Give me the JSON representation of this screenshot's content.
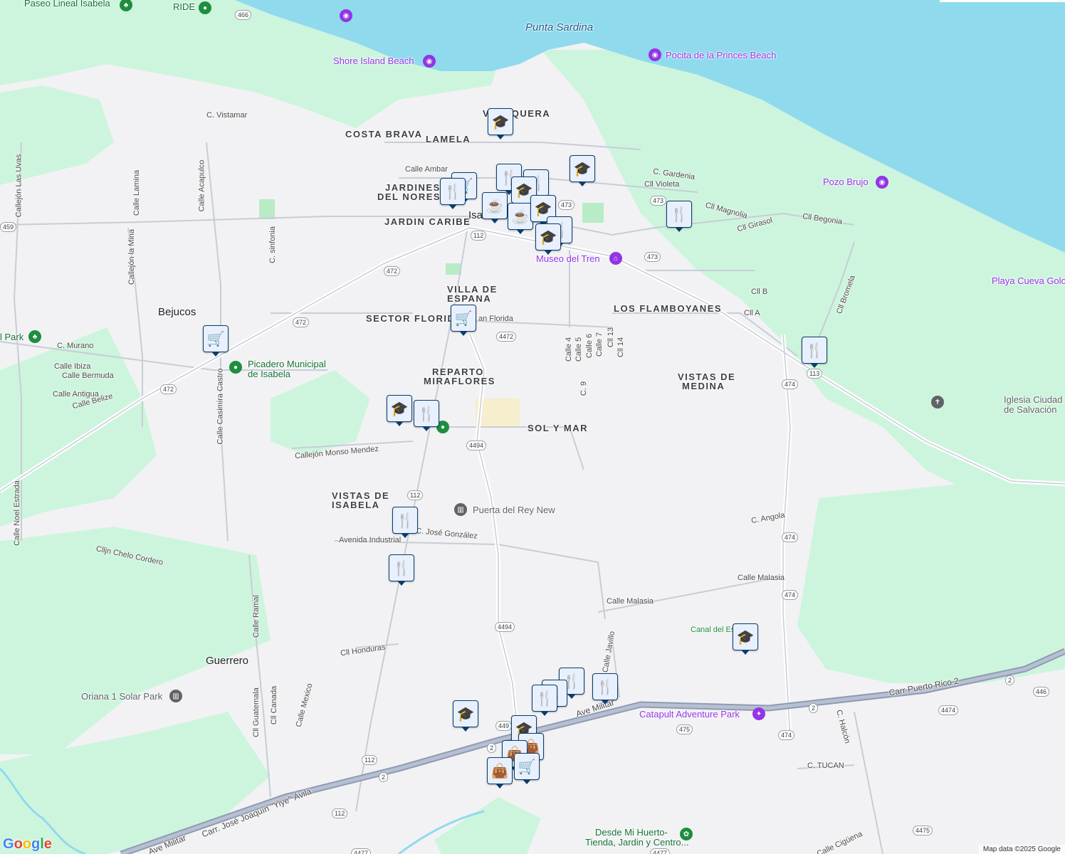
{
  "map": {
    "colors": {
      "land": "#f2f2f4",
      "water": "#90daee",
      "park": "#cdf5dd",
      "road": "#c7cdd6",
      "highway": "#8f9bb3",
      "pin_bg": "#e8f0fe",
      "pin_border": "#0b3d6b",
      "poi_purple": "#9334e6"
    },
    "water_labels": {
      "punta": "Punta Sardina"
    },
    "areas": {
      "costa_brava": "COSTA BRAVA",
      "lamela": "LAMELA",
      "jardines": "JARDINES",
      "del_noreste": "DEL NOREST",
      "jardin_caribe": "JARDIN CARIBE",
      "villa_espana_1": "VILLA DE",
      "villa_espana_2": "ESPANA",
      "sector_florida": "SECTOR FLORIDA",
      "reparto_1": "REPARTO",
      "reparto_2": "MIRAFLORES",
      "sol_y_mar": "SOL Y MAR",
      "los_flamboyanes": "LOS FLAMBOYANES",
      "vistas_medina_1": "VISTAS DE",
      "vistas_medina_2": "MEDINA",
      "vistas_isabela_1": "VISTAS DE",
      "vistas_isabela_2": "ISABELA",
      "villa_pesquera": "VI      ESQUERA"
    },
    "cities": {
      "bejucos": "Bejucos",
      "guerrero": "Guerrero",
      "isabela": "Isa"
    },
    "streets": {
      "c_vistamar": "C. Vistamar",
      "calle_ambar": "Calle Ambar",
      "c_gardenia": "C. Gardenia",
      "cll_violeta": "Cll Violeta",
      "cll_magnolia": "Cll Magnolia",
      "cll_girasol": "Cll Girasol",
      "cll_begonia": "Cll Begonia",
      "cll_b": "Cll B",
      "cll_a": "Cll A",
      "cll_bromela": "Cll Bromela",
      "calle_4": "Calle 4",
      "calle_5": "Calle 5",
      "calle_6": "Calle 6",
      "calle_7": "Calle 7",
      "cll_13": "Cll 13",
      "cll_14": "Cll 14",
      "c_9": "C. 9",
      "c_murano": "C. Murano",
      "calle_ibiza": "Calle Ibiza",
      "calle_bermuda": "Calle Bermuda",
      "calle_antigua": "Calle Antigua",
      "calle_belize": "Calle Belize",
      "callejon_las_uvas": "Callejón Las Uvas",
      "calle_lamina": "Calle Lamina",
      "callejon_la_mina": "Callejón la Mina",
      "calle_acapulco": "Calle Acapulco",
      "c_sinfonia": "C. sinfonia",
      "calle_casimira": "Calle Casimira Castro",
      "callejon_monso": "Callejón Monso Mendez",
      "calle_noel": "Calle Noel Estrada",
      "avenida_industrial": "Avenida Industrial",
      "c_jose_gonzalez": "C. José González",
      "clljn_chelo": "Clljn Chelo Cordero",
      "calle_ramal": "Calle Ramal",
      "cll_honduras": "Cll Honduras",
      "calle_mexico": "Calle Mexico",
      "cll_canada": "Cll Canada",
      "cll_guatemala": "Cll Guatemala",
      "c_angola": "C. Angola",
      "calle_malasia_1": "Calle Malasia",
      "calle_malasia_2": "Calle Malasia",
      "calle_javillo": "Calle Javillo",
      "ave_militar_1": "Ave Militar",
      "ave_militar_2": "Ave Militar",
      "carr_jose": "Carr. José Joaquín \"Yiye\" Ávila",
      "carr_pr2": "Carr Puerto Rico 2",
      "c_halcon": "C. Halcón",
      "c_tucan": "C. TUCAN",
      "calle_ciguena": "Calle Cigüena",
      "san_florida": "an Florida",
      "canal": "Canal del Est"
    },
    "shields": [
      "466",
      "459",
      "112",
      "472",
      "472",
      "472",
      "4472",
      "473",
      "473",
      "473",
      "113",
      "474",
      "474",
      "474",
      "474",
      "4494",
      "4494",
      "112",
      "112",
      "2",
      "2",
      "2",
      "2",
      "475",
      "446",
      "4474",
      "4475",
      "4477",
      "4477",
      "112",
      "449"
    ],
    "pois": {
      "paseo": "Paseo Lineal Isabela",
      "ride": "RIDE",
      "shore_island": "Shore Island Beach",
      "pocita": "Pocita de la Princes Beach",
      "pozo_brujo": "Pozo Brujo",
      "museo": "Museo del Tren",
      "playa_cueva": "Playa Cueva Golo",
      "iglesia_1": "Iglesia Ciudad",
      "iglesia_2": "de Salvación",
      "picadero_1": "Picadero Municipal",
      "picadero_2": "de Isabela",
      "park": "l Park",
      "puerta": "Puerta del Rey New",
      "catapult": "Catapult Adventure Park",
      "oriana": "Oriana 1 Solar Park",
      "desde_1": "Desde Mi Huerto-",
      "desde_2": "Tienda, Jardin y Centro..."
    },
    "pins": [
      {
        "icon": "school-icon",
        "glyph": "🎓"
      },
      {
        "icon": "school-icon",
        "glyph": "🎓"
      },
      {
        "icon": "restaurant-icon",
        "glyph": "🍴"
      },
      {
        "icon": "shopping-cart-icon",
        "glyph": "🛒"
      },
      {
        "icon": "restaurant-icon",
        "glyph": "🍴"
      },
      {
        "icon": "restaurant-icon",
        "glyph": "🍴"
      },
      {
        "icon": "school-icon",
        "glyph": "🎓"
      },
      {
        "icon": "cafe-icon",
        "glyph": "☕"
      },
      {
        "icon": "cafe-icon",
        "glyph": "☕"
      },
      {
        "icon": "school-icon",
        "glyph": "🎓"
      },
      {
        "icon": "restaurant-icon",
        "glyph": "🍴"
      },
      {
        "icon": "school-icon",
        "glyph": "🎓"
      },
      {
        "icon": "restaurant-icon",
        "glyph": "🍴"
      },
      {
        "icon": "shopping-cart-icon",
        "glyph": "🛒"
      },
      {
        "icon": "shopping-cart-icon",
        "glyph": "🛒"
      },
      {
        "icon": "restaurant-icon",
        "glyph": "🍴"
      },
      {
        "icon": "school-icon",
        "glyph": "🎓"
      },
      {
        "icon": "restaurant-icon",
        "glyph": "🍴"
      },
      {
        "icon": "restaurant-icon",
        "glyph": "🍴"
      },
      {
        "icon": "restaurant-icon",
        "glyph": "🍴"
      },
      {
        "icon": "school-icon",
        "glyph": "🎓"
      },
      {
        "icon": "restaurant-icon",
        "glyph": "🍴"
      },
      {
        "icon": "restaurant-icon",
        "glyph": "🍴"
      },
      {
        "icon": "restaurant-icon",
        "glyph": "🍴"
      },
      {
        "icon": "restaurant-icon",
        "glyph": "🍴"
      },
      {
        "icon": "school-icon",
        "glyph": "🎓"
      },
      {
        "icon": "school-icon",
        "glyph": "🎓"
      },
      {
        "icon": "shopping-bag-icon",
        "glyph": "👜"
      },
      {
        "icon": "shopping-bag-icon",
        "glyph": "👜"
      },
      {
        "icon": "shopping-cart-icon",
        "glyph": "🛒"
      },
      {
        "icon": "shopping-bag-icon",
        "glyph": "👜"
      }
    ],
    "attribution": {
      "google": "Google",
      "data": "Map data ©2025 Google"
    }
  }
}
